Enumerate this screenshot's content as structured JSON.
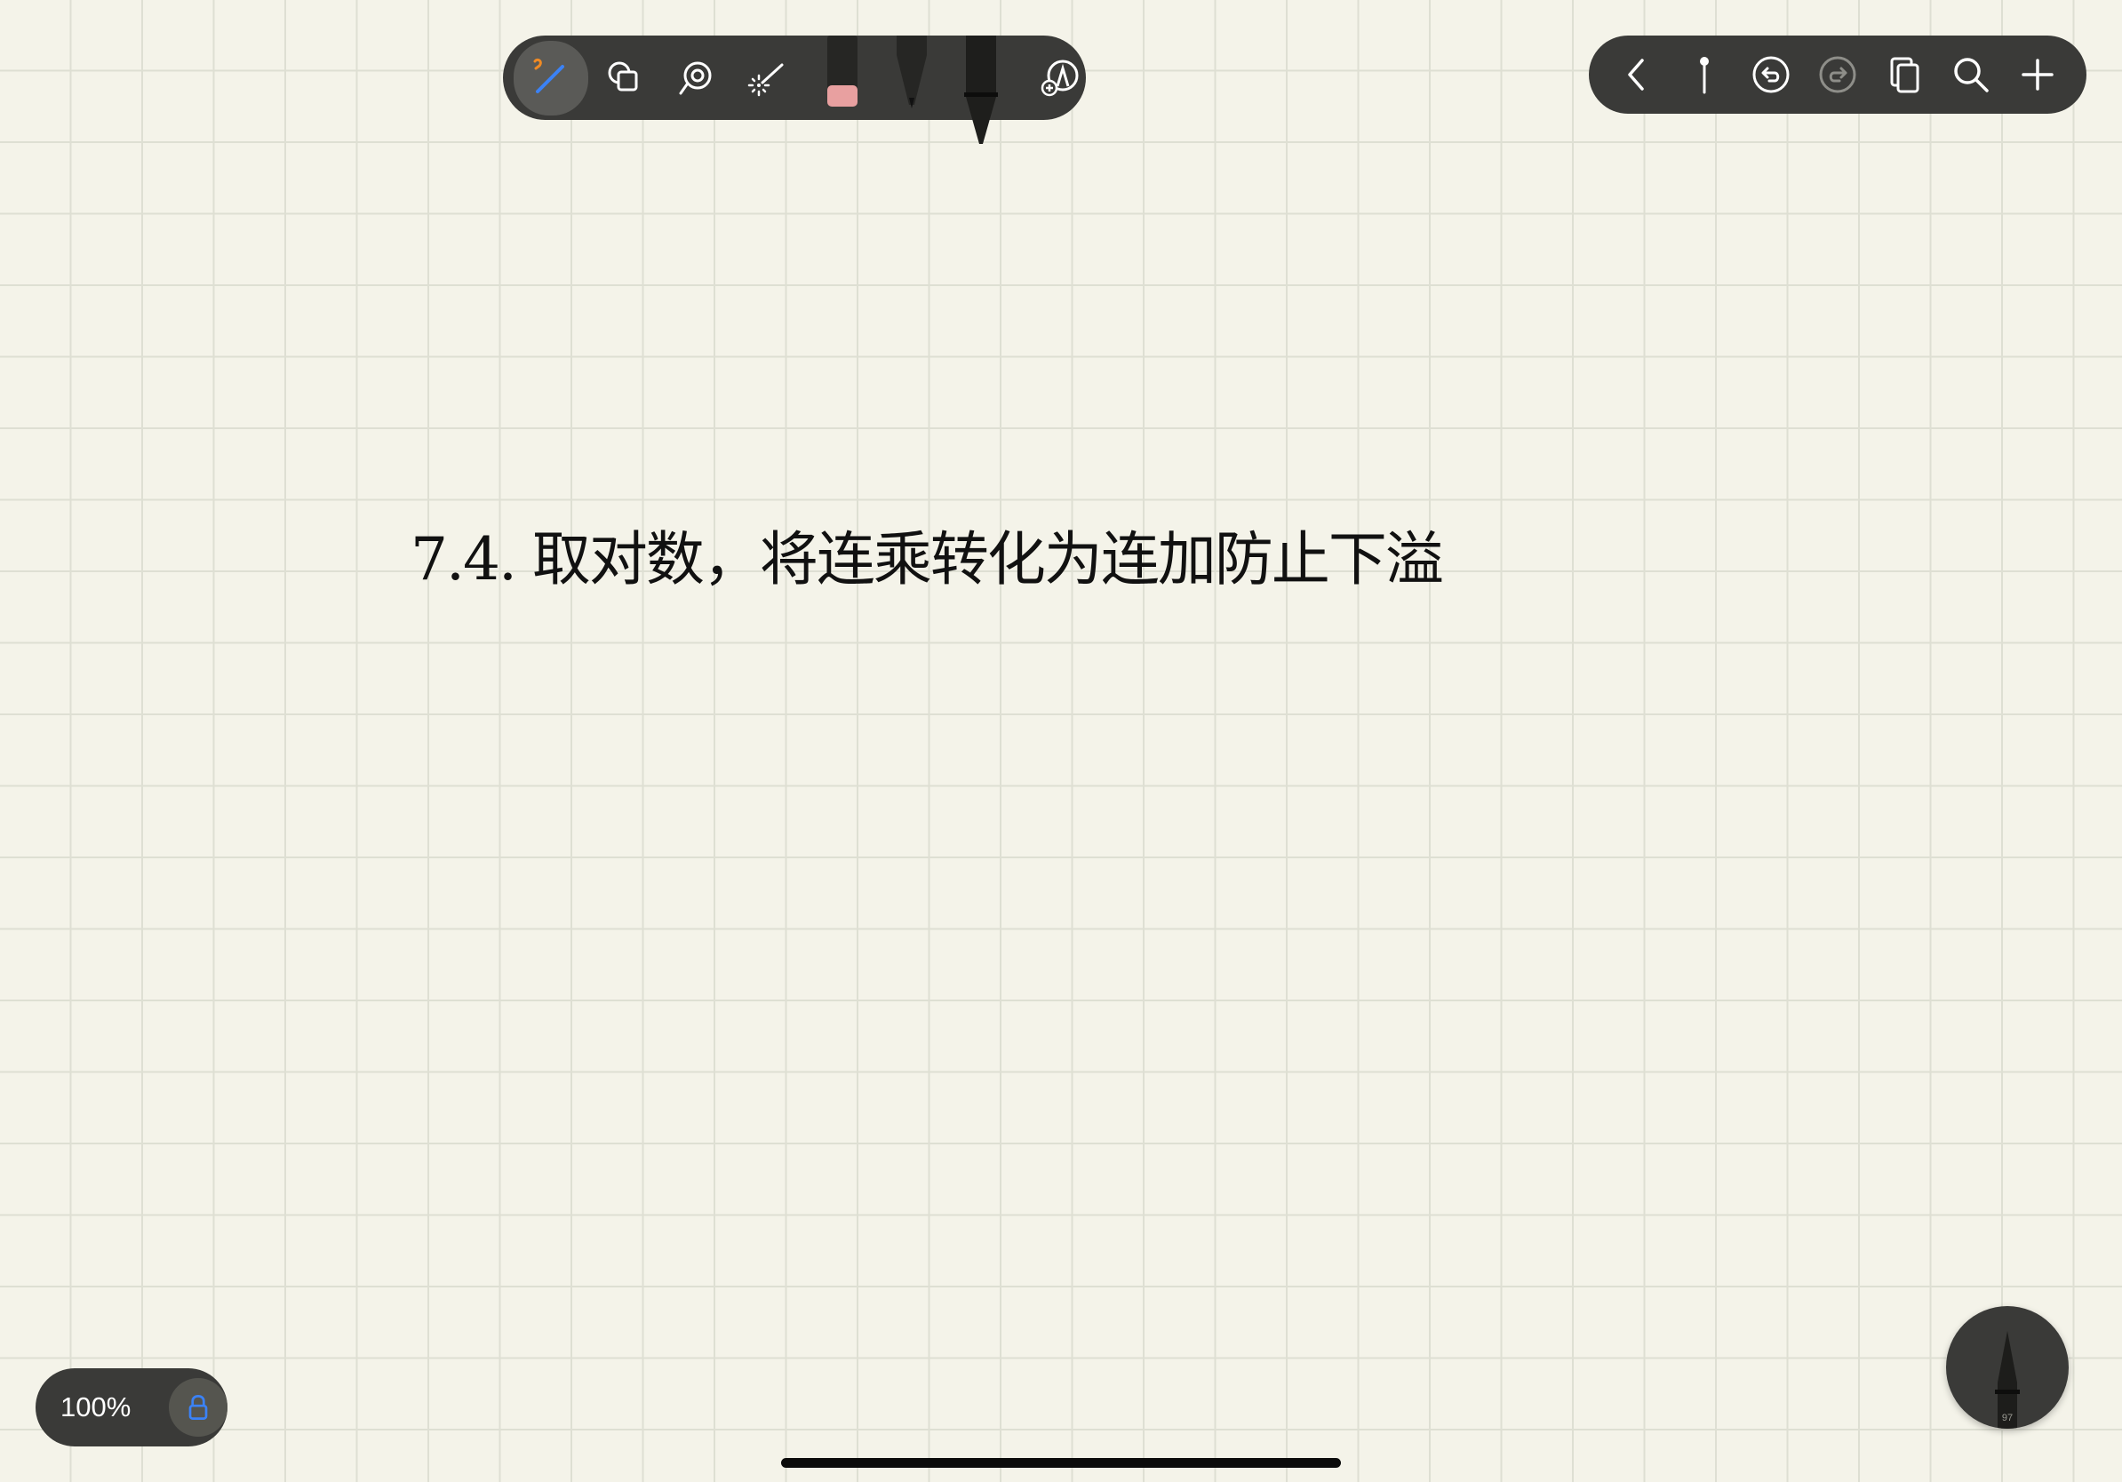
{
  "toolbar_tools": {
    "items": [
      {
        "name": "pen-tool",
        "active": true
      },
      {
        "name": "shapes-tool"
      },
      {
        "name": "lasso-tool"
      },
      {
        "name": "laser-pointer-tool"
      },
      {
        "name": "eraser"
      },
      {
        "name": "ballpoint-pen"
      },
      {
        "name": "fountain-pen",
        "selected": true
      },
      {
        "name": "add-tool"
      }
    ]
  },
  "toolbar_nav": {
    "items": [
      "back-icon",
      "pin-icon",
      "undo-icon",
      "redo-icon",
      "pages-icon",
      "search-icon",
      "add-icon"
    ]
  },
  "canvas": {
    "note_text": "7.4. 取对数，将连乘转化为连加防止下溢"
  },
  "zoom": {
    "label": "100%"
  },
  "pen_fab": {
    "size_label": "97"
  },
  "colors": {
    "toolbar_bg": "#3a3a38",
    "page_bg": "#f4f3e9",
    "grid": "#dedfd3",
    "active_tool": "#3b82f6",
    "accent_orange": "#f08a24",
    "eraser_pink": "#e8a0a0"
  }
}
